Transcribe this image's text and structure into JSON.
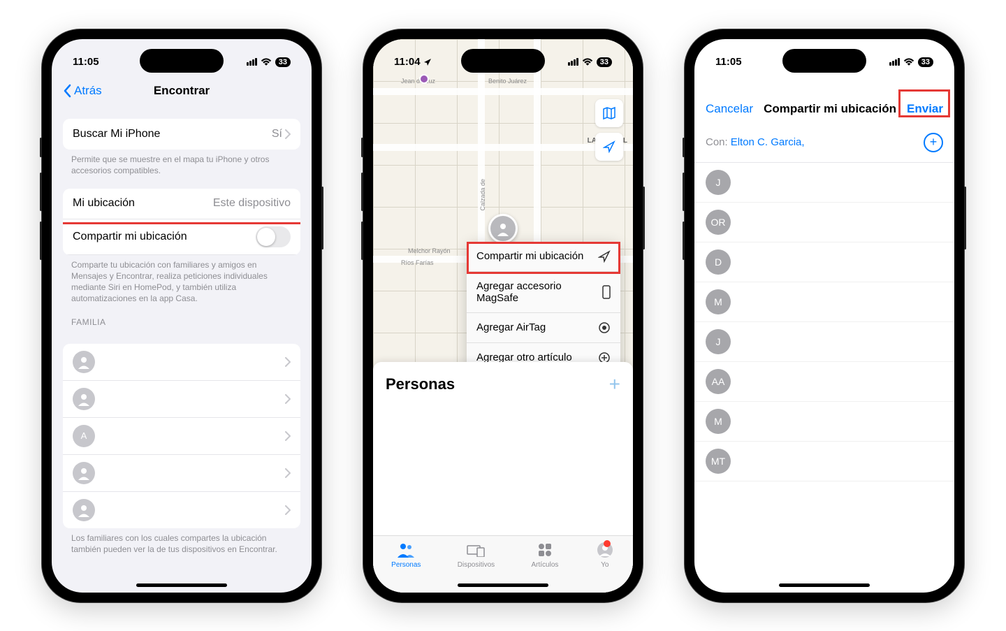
{
  "status": {
    "time1": "11:05",
    "time2": "11:04",
    "time3": "11:05",
    "battery": "33"
  },
  "p1": {
    "back": "Atrás",
    "title": "Encontrar",
    "find_my_iphone": "Buscar Mi iPhone",
    "find_my_iphone_val": "Sí",
    "find_my_footer": "Permite que se muestre en el mapa tu iPhone y otros accesorios compatibles.",
    "my_location": "Mi ubicación",
    "my_location_val": "Este dispositivo",
    "share_location": "Compartir mi ubicación",
    "share_footer": "Comparte tu ubicación con familiares y amigos en Mensajes y Encontrar, realiza peticiones individuales mediante Siri en HomePod, y también utiliza automatizaciones en la app Casa.",
    "family_header": "FAMILIA",
    "family": [
      "",
      "",
      "A",
      "",
      ""
    ],
    "family_footer": "Los familiares con los cuales compartes la ubicación también pueden ver la de tus dispositivos en Encontrar."
  },
  "p2": {
    "streets": {
      "benito": "Benito Juárez",
      "jean": "Jean de Luz",
      "candel": "LA CANDEL",
      "rayon": "Melchor Rayón",
      "calzada": "Calzada de",
      "farias": "Ríos Farías"
    },
    "popup": {
      "share": "Compartir mi ubicación",
      "magsafe": "Agregar accesorio MagSafe",
      "airtag": "Agregar AirTag",
      "other": "Agregar otro artículo"
    },
    "sheet_title": "Personas",
    "tabs": {
      "personas": "Personas",
      "dispositivos": "Dispositivos",
      "articulos": "Artículos",
      "yo": "Yo"
    }
  },
  "p3": {
    "cancel": "Cancelar",
    "title": "Compartir mi ubicación",
    "send": "Enviar",
    "con_k": "Con:",
    "con_v": "Elton C. Garcia,",
    "contacts": [
      "J",
      "OR",
      "D",
      "M",
      "J",
      "AA",
      "M",
      "MT"
    ]
  }
}
